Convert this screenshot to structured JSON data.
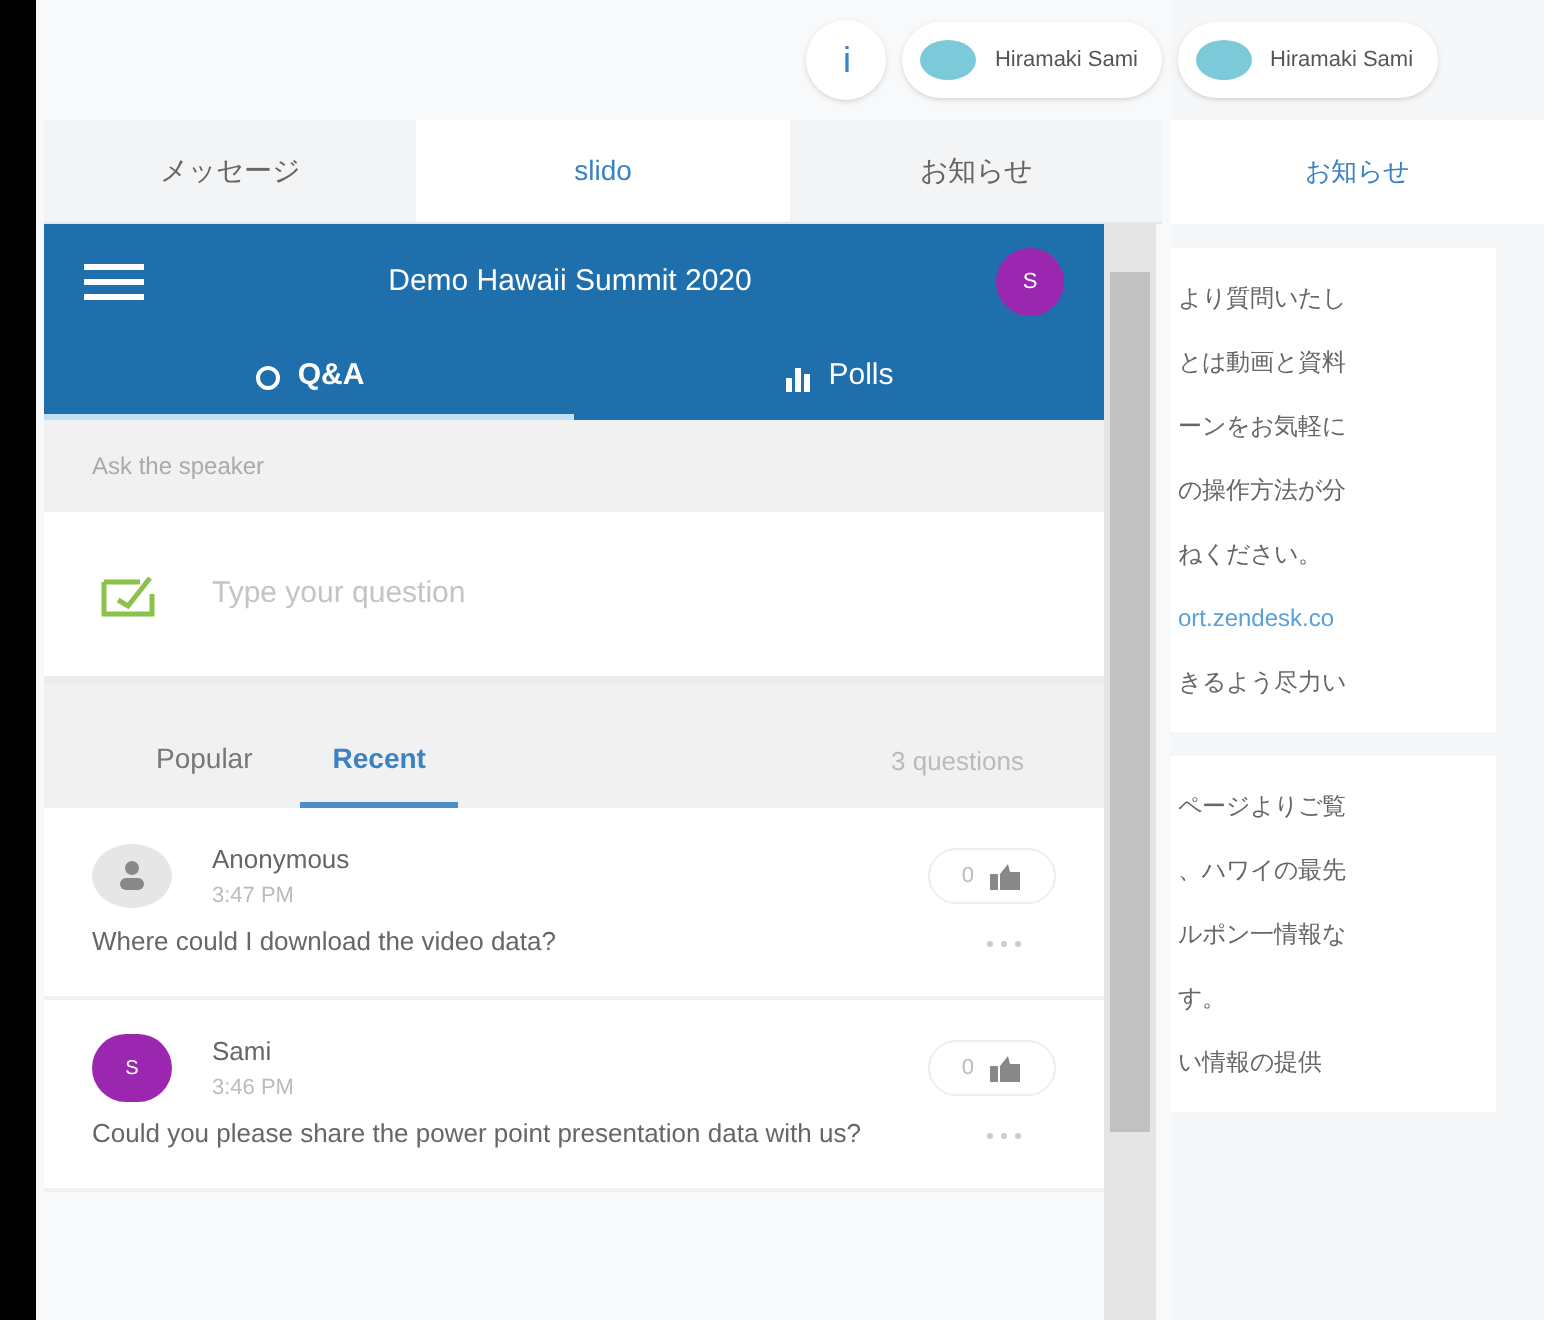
{
  "top_bar": {
    "info_button": "i",
    "users": [
      {
        "name": "Hiramaki Sami"
      },
      {
        "name": "Hiramaki Sami"
      }
    ]
  },
  "tabs": [
    {
      "label": "メッセージ",
      "selected": false
    },
    {
      "label": "slido",
      "selected": true
    },
    {
      "label": "お知らせ",
      "selected": false
    }
  ],
  "slido": {
    "title": "Demo Hawaii Summit 2020",
    "avatar": "S",
    "tabs": [
      {
        "label": "Q&A",
        "kind": "qa",
        "selected": true
      },
      {
        "label": "Polls",
        "kind": "polls",
        "selected": false
      }
    ],
    "ask_label": "Ask the speaker",
    "question_field": {
      "placeholder": "Type your question"
    },
    "sort_tabs": [
      {
        "label": "Popular",
        "selected": false
      },
      {
        "label": "Recent",
        "selected": true
      }
    ],
    "count": "3 questions",
    "questions": [
      {
        "author": "Anonymous",
        "anonymous": true,
        "time": "3:47 PM",
        "likes": "0",
        "text": "Where could I download the video data?"
      },
      {
        "author": "Sami",
        "anonymous": false,
        "avatar": "S",
        "time": "3:46 PM",
        "likes": "0",
        "text": "Could you please share the power point presentation data with us?"
      }
    ]
  },
  "side_panel": {
    "tab": "お知らせ",
    "cards": [
      {
        "lines": [
          {
            "text": "より質問いたし"
          },
          {
            "text": "とは動画と資料"
          },
          {
            "text": "ーンをお気軽に"
          },
          {
            "text": "の操作方法が分"
          },
          {
            "text": "ねください。"
          },
          {
            "text": "ort.zendesk.co",
            "kind": "link"
          },
          {
            "text": "きるよう尽力い"
          }
        ]
      },
      {
        "lines": [
          {
            "text": "ページよりご覧"
          },
          {
            "text": "、ハワイの最先"
          },
          {
            "text": "ルポン一情報な"
          },
          {
            "text": "す。"
          },
          {
            "text": "い情報の提供"
          }
        ]
      }
    ]
  }
}
